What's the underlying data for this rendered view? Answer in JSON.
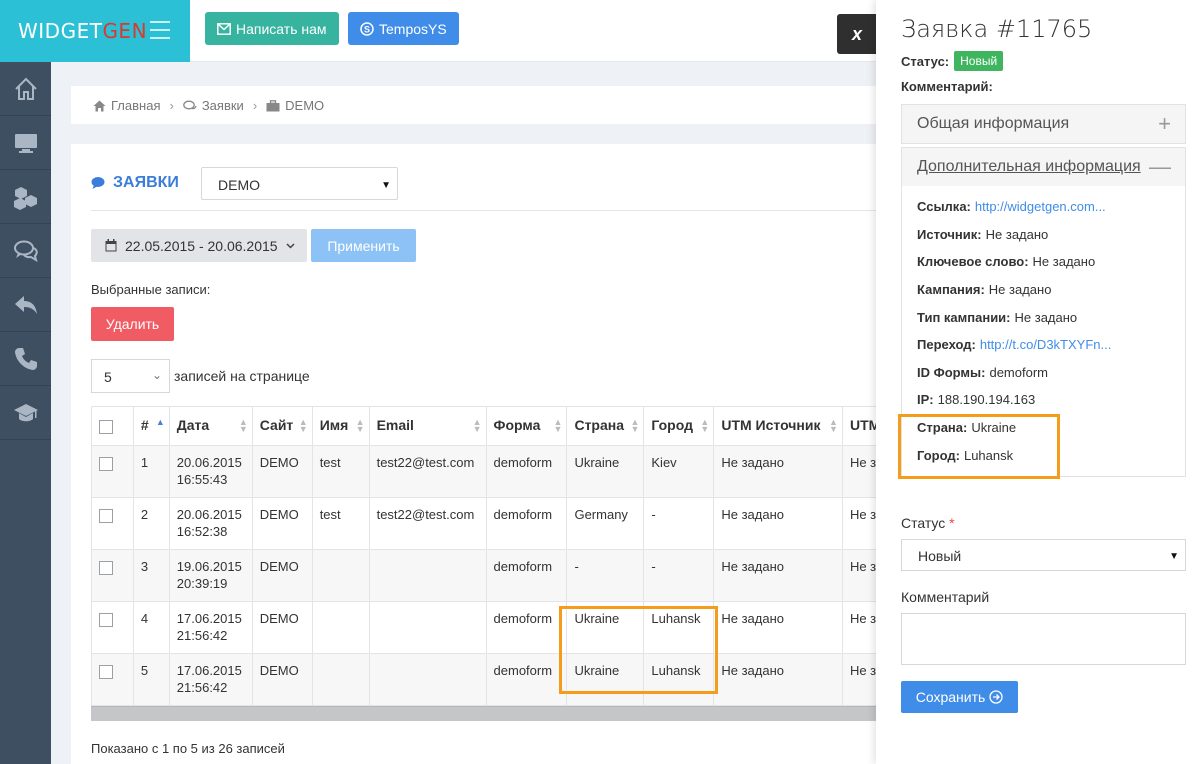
{
  "brand": {
    "part1": "WIDGET",
    "part2": "GEN"
  },
  "topbar": {
    "write_label": "Написать нам",
    "skype_label": "TemposYS",
    "close_label": "x"
  },
  "breadcrumb": {
    "home": "Главная",
    "requests": "Заявки",
    "current": "DEMO"
  },
  "panel": {
    "title": "ЗАЯВКИ",
    "site_select": "DEMO",
    "date_range": "22.05.2015 - 20.06.2015",
    "apply_label": "Применить",
    "selected_label": "Выбранные записи:",
    "delete_label": "Удалить",
    "per_page_value": "5",
    "per_page_label": "записей на странице",
    "shown_label": "Показано с 1 по 5 из 26 записей"
  },
  "table": {
    "headers": {
      "num": "#",
      "date": "Дата",
      "site": "Сайт",
      "name": "Имя",
      "email": "Email",
      "form": "Форма",
      "country": "Страна",
      "city": "Город",
      "utm_source": "UTM Источник",
      "utm_cut": "UTM"
    },
    "rows": [
      {
        "num": "1",
        "date": "20.06.2015",
        "time": "16:55:43",
        "site": "DEMO",
        "name": "test",
        "email": "test22@test.com",
        "form": "demoform",
        "country": "Ukraine",
        "city": "Kiev",
        "utm_source": "Не задано",
        "utm_cut": "Не з"
      },
      {
        "num": "2",
        "date": "20.06.2015",
        "time": "16:52:38",
        "site": "DEMO",
        "name": "test",
        "email": "test22@test.com",
        "form": "demoform",
        "country": "Germany",
        "city": "-",
        "utm_source": "Не задано",
        "utm_cut": "Не з"
      },
      {
        "num": "3",
        "date": "19.06.2015",
        "time": "20:39:19",
        "site": "DEMO",
        "name": "",
        "email": "",
        "form": "demoform",
        "country": "-",
        "city": "-",
        "utm_source": "Не задано",
        "utm_cut": "Не з"
      },
      {
        "num": "4",
        "date": "17.06.2015",
        "time": "21:56:42",
        "site": "DEMO",
        "name": "",
        "email": "",
        "form": "demoform",
        "country": "Ukraine",
        "city": "Luhansk",
        "utm_source": "Не задано",
        "utm_cut": "Не з"
      },
      {
        "num": "5",
        "date": "17.06.2015",
        "time": "21:56:42",
        "site": "DEMO",
        "name": "",
        "email": "",
        "form": "demoform",
        "country": "Ukraine",
        "city": "Luhansk",
        "utm_source": "Не задано",
        "utm_cut": "Не з"
      }
    ]
  },
  "drawer": {
    "title": "Заявка #11765",
    "status_label": "Статус:",
    "status_value": "Новый",
    "comment_label": "Комментарий:",
    "acc_general": "Общая информация",
    "acc_general_sign": "+",
    "acc_extra": "Дополнительная информация",
    "acc_extra_sign": "—",
    "info": [
      {
        "label": "Ссылка:",
        "value": "http://widgetgen.com...",
        "link": true
      },
      {
        "label": "Источник:",
        "value": "Не задано",
        "link": false
      },
      {
        "label": "Ключевое слово:",
        "value": "Не задано",
        "link": false
      },
      {
        "label": "Кампания:",
        "value": "Не задано",
        "link": false
      },
      {
        "label": "Тип кампании:",
        "value": "Не задано",
        "link": false
      },
      {
        "label": "Переход:",
        "value": "http://t.co/D3kTXYFn...",
        "link": true
      },
      {
        "label": "ID Формы:",
        "value": "demoform",
        "link": false
      },
      {
        "label": "IP:",
        "value": "188.190.194.163",
        "link": false
      },
      {
        "label": "Страна:",
        "value": "Ukraine",
        "link": false
      },
      {
        "label": "Город:",
        "value": "Luhansk",
        "link": false
      }
    ],
    "status_field_label": "Статус",
    "required_mark": "*",
    "status_select": "Новый",
    "comment_field_label": "Комментарий",
    "save_label": "Сохранить"
  },
  "colors": {
    "accent": "#2bc0d6",
    "primary": "#3f8de8",
    "danger": "#f15b64",
    "success": "#3eb55e",
    "highlight": "#f59d1a",
    "sidebar": "#3e4f61"
  }
}
